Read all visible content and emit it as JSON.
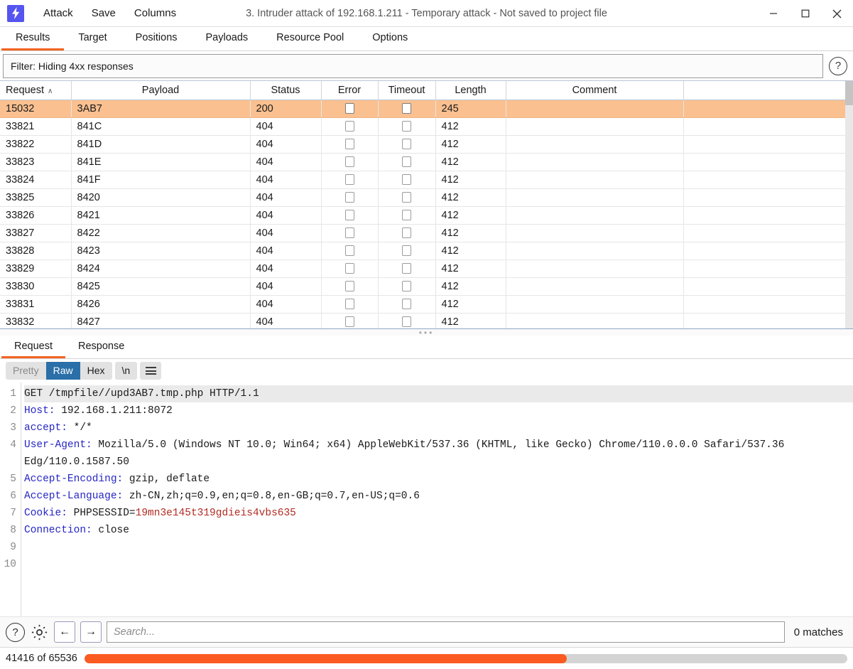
{
  "window": {
    "logo_icon": "burp-lightning-icon",
    "logo_glyph": "⚡",
    "title": "3. Intruder attack of 192.168.1.211 - Temporary attack - Not saved to project file",
    "menu": [
      {
        "label": "Attack"
      },
      {
        "label": "Save"
      },
      {
        "label": "Columns"
      }
    ],
    "controls": [
      {
        "name": "minimize-button",
        "icon": "minimize-icon"
      },
      {
        "name": "maximize-button",
        "icon": "maximize-icon"
      },
      {
        "name": "close-button",
        "icon": "close-icon"
      }
    ]
  },
  "tabs": [
    {
      "label": "Results",
      "active": true
    },
    {
      "label": "Target",
      "active": false
    },
    {
      "label": "Positions",
      "active": false
    },
    {
      "label": "Payloads",
      "active": false
    },
    {
      "label": "Resource Pool",
      "active": false
    },
    {
      "label": "Options",
      "active": false
    }
  ],
  "filter": {
    "text": "Filter: Hiding 4xx responses",
    "help_glyph": "?"
  },
  "results_table": {
    "sort_column": "Request",
    "sort_arrow": "∧",
    "columns": [
      "Request",
      "Payload",
      "Status",
      "Error",
      "Timeout",
      "Length",
      "Comment"
    ],
    "rows": [
      {
        "request": "15032",
        "payload": "3AB7",
        "status": "200",
        "error": false,
        "timeout": false,
        "length": "245",
        "comment": "",
        "highlighted": true
      },
      {
        "request": "33821",
        "payload": "841C",
        "status": "404",
        "error": false,
        "timeout": false,
        "length": "412",
        "comment": "",
        "highlighted": false
      },
      {
        "request": "33822",
        "payload": "841D",
        "status": "404",
        "error": false,
        "timeout": false,
        "length": "412",
        "comment": "",
        "highlighted": false
      },
      {
        "request": "33823",
        "payload": "841E",
        "status": "404",
        "error": false,
        "timeout": false,
        "length": "412",
        "comment": "",
        "highlighted": false
      },
      {
        "request": "33824",
        "payload": "841F",
        "status": "404",
        "error": false,
        "timeout": false,
        "length": "412",
        "comment": "",
        "highlighted": false
      },
      {
        "request": "33825",
        "payload": "8420",
        "status": "404",
        "error": false,
        "timeout": false,
        "length": "412",
        "comment": "",
        "highlighted": false
      },
      {
        "request": "33826",
        "payload": "8421",
        "status": "404",
        "error": false,
        "timeout": false,
        "length": "412",
        "comment": "",
        "highlighted": false
      },
      {
        "request": "33827",
        "payload": "8422",
        "status": "404",
        "error": false,
        "timeout": false,
        "length": "412",
        "comment": "",
        "highlighted": false
      },
      {
        "request": "33828",
        "payload": "8423",
        "status": "404",
        "error": false,
        "timeout": false,
        "length": "412",
        "comment": "",
        "highlighted": false
      },
      {
        "request": "33829",
        "payload": "8424",
        "status": "404",
        "error": false,
        "timeout": false,
        "length": "412",
        "comment": "",
        "highlighted": false
      },
      {
        "request": "33830",
        "payload": "8425",
        "status": "404",
        "error": false,
        "timeout": false,
        "length": "412",
        "comment": "",
        "highlighted": false
      },
      {
        "request": "33831",
        "payload": "8426",
        "status": "404",
        "error": false,
        "timeout": false,
        "length": "412",
        "comment": "",
        "highlighted": false
      },
      {
        "request": "33832",
        "payload": "8427",
        "status": "404",
        "error": false,
        "timeout": false,
        "length": "412",
        "comment": "",
        "highlighted": false
      }
    ]
  },
  "message_tabs": [
    {
      "label": "Request",
      "active": true
    },
    {
      "label": "Response",
      "active": false
    }
  ],
  "editor_toolbar": {
    "pretty_label": "Pretty",
    "raw_label": "Raw",
    "hex_label": "Hex",
    "newline_label": "\\n",
    "menu_icon": "hamburger-icon",
    "selected": "Raw"
  },
  "request": {
    "line_numbers": [
      "1",
      "2",
      "3",
      "4",
      "5",
      "6",
      "7",
      "8",
      "9",
      "10"
    ],
    "lines": [
      {
        "n": "1",
        "text": "GET /tmpfile//upd3AB7.tmp.php HTTP/1.1",
        "first": true
      },
      {
        "n": "2",
        "name": "Host:",
        "value": " 192.168.1.211:8072"
      },
      {
        "n": "3",
        "name": "accept:",
        "value": " */*"
      },
      {
        "n": "4",
        "name": "User-Agent:",
        "value": " Mozilla/5.0 (Windows NT 10.0; Win64; x64) AppleWebKit/537.36 (KHTML, like Gecko) Chrome/110.0.0.0 Safari/537.36 Edg/110.0.1587.50"
      },
      {
        "n": "5",
        "name": "Accept-Encoding:",
        "value": " gzip, deflate"
      },
      {
        "n": "6",
        "name": "Accept-Language:",
        "value": " zh-CN,zh;q=0.9,en;q=0.8,en-GB;q=0.7,en-US;q=0.6"
      },
      {
        "n": "7",
        "name": "Cookie:",
        "value": " PHPSESSID=",
        "cookie": "19mn3e145t319gdieis4vbs635"
      },
      {
        "n": "8",
        "name": "Connection:",
        "value": " close"
      },
      {
        "n": "9",
        "text": ""
      },
      {
        "n": "10",
        "text": ""
      }
    ]
  },
  "search": {
    "help_glyph": "?",
    "help_icon": "help-icon",
    "settings_icon": "gear-icon",
    "prev_icon": "arrow-left-icon",
    "next_icon": "arrow-right-icon",
    "prev_glyph": "←",
    "next_glyph": "→",
    "placeholder": "Search...",
    "value": "",
    "matches_label": "0 matches"
  },
  "status": {
    "count_label": "41416 of 65536",
    "progress_percent": 63.2,
    "progress_color": "#fb5b21",
    "track_color": "#d4d4d4"
  },
  "colors": {
    "accent": "#f26321",
    "highlight_row": "#fac090",
    "selected_button": "#2a6fa8",
    "header_name": "#2626c4",
    "cookie_value": "#b12b23"
  }
}
